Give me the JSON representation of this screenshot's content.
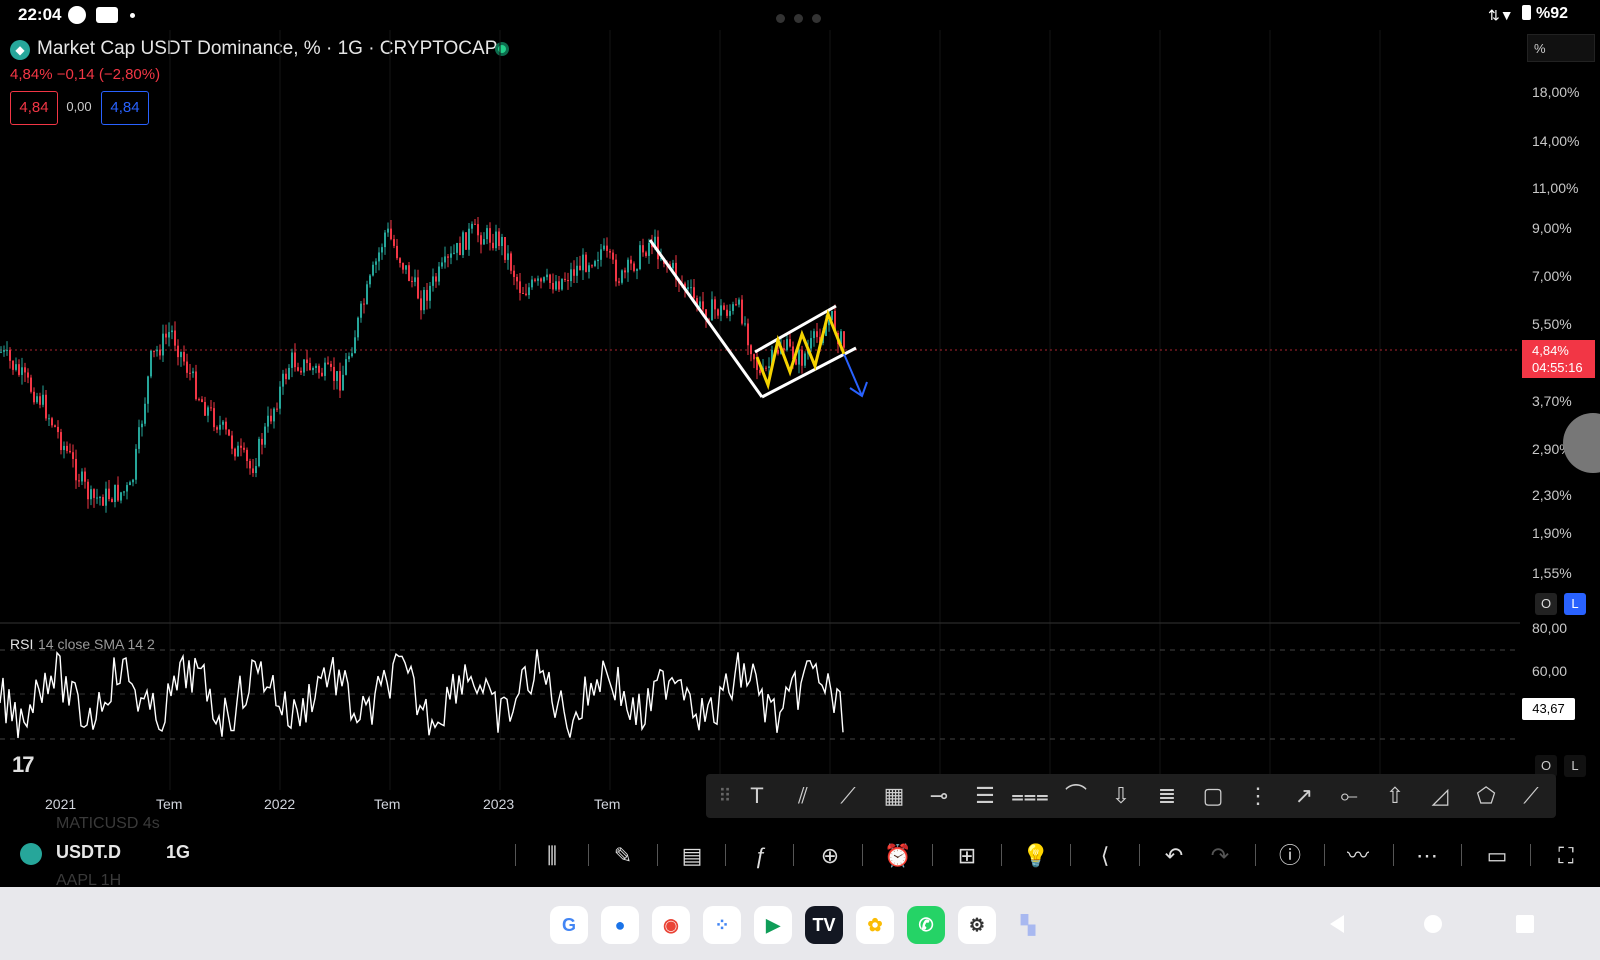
{
  "status_bar": {
    "time": "22:04",
    "battery": "%92"
  },
  "header": {
    "title": "Market Cap USDT Dominance, % · 1G · CRYPTOCAP",
    "price_change": "4,84%  −0,14 (−2,80%)",
    "bid": "4,84",
    "spread": "0,00",
    "ask": "4,84"
  },
  "price_axis": {
    "unit_button": "%",
    "labels": [
      "18,00%",
      "14,00%",
      "11,00%",
      "9,00%",
      "7,00%",
      "5,50%",
      "3,70%",
      "2,90%",
      "2,30%",
      "1,90%",
      "1,55%"
    ],
    "current_price": "4,84%",
    "countdown": "04:55:16",
    "scale_buttons": [
      "O",
      "L"
    ]
  },
  "rsi": {
    "label": "RSI",
    "params": "14 close SMA 14 2",
    "axis_labels": [
      "80,00",
      "60,00"
    ],
    "current_value": "43,67",
    "scale_buttons": [
      "O",
      "L"
    ]
  },
  "time_axis": [
    {
      "text": "2021",
      "bold": true
    },
    {
      "text": "Tem",
      "bold": false
    },
    {
      "text": "2022",
      "bold": true
    },
    {
      "text": "Tem",
      "bold": false
    },
    {
      "text": "2023",
      "bold": true
    },
    {
      "text": "Tem",
      "bold": false
    }
  ],
  "bottom_bar": {
    "ticker": "USDT.D",
    "interval": "1G",
    "ghost_above": "MATICUSD  4s",
    "ghost_below": "AAPL         1H"
  },
  "drawing_tools": [
    "drag-handle",
    "text-tool",
    "parallel-channel",
    "trend-line",
    "fib-grid",
    "horizontal-ray",
    "pitchfork",
    "fib-fan",
    "curve-tool",
    "arrow-down",
    "fib-channel",
    "rectangle",
    "gann-box",
    "arrow-marker",
    "horizontal-line",
    "arrow-up",
    "triangle-pattern",
    "xabcd-pattern",
    "ruler-line"
  ],
  "colors": {
    "bg": "#000000",
    "down": "#f23645",
    "up": "#26a69a",
    "accent_blue": "#2962ff"
  }
}
